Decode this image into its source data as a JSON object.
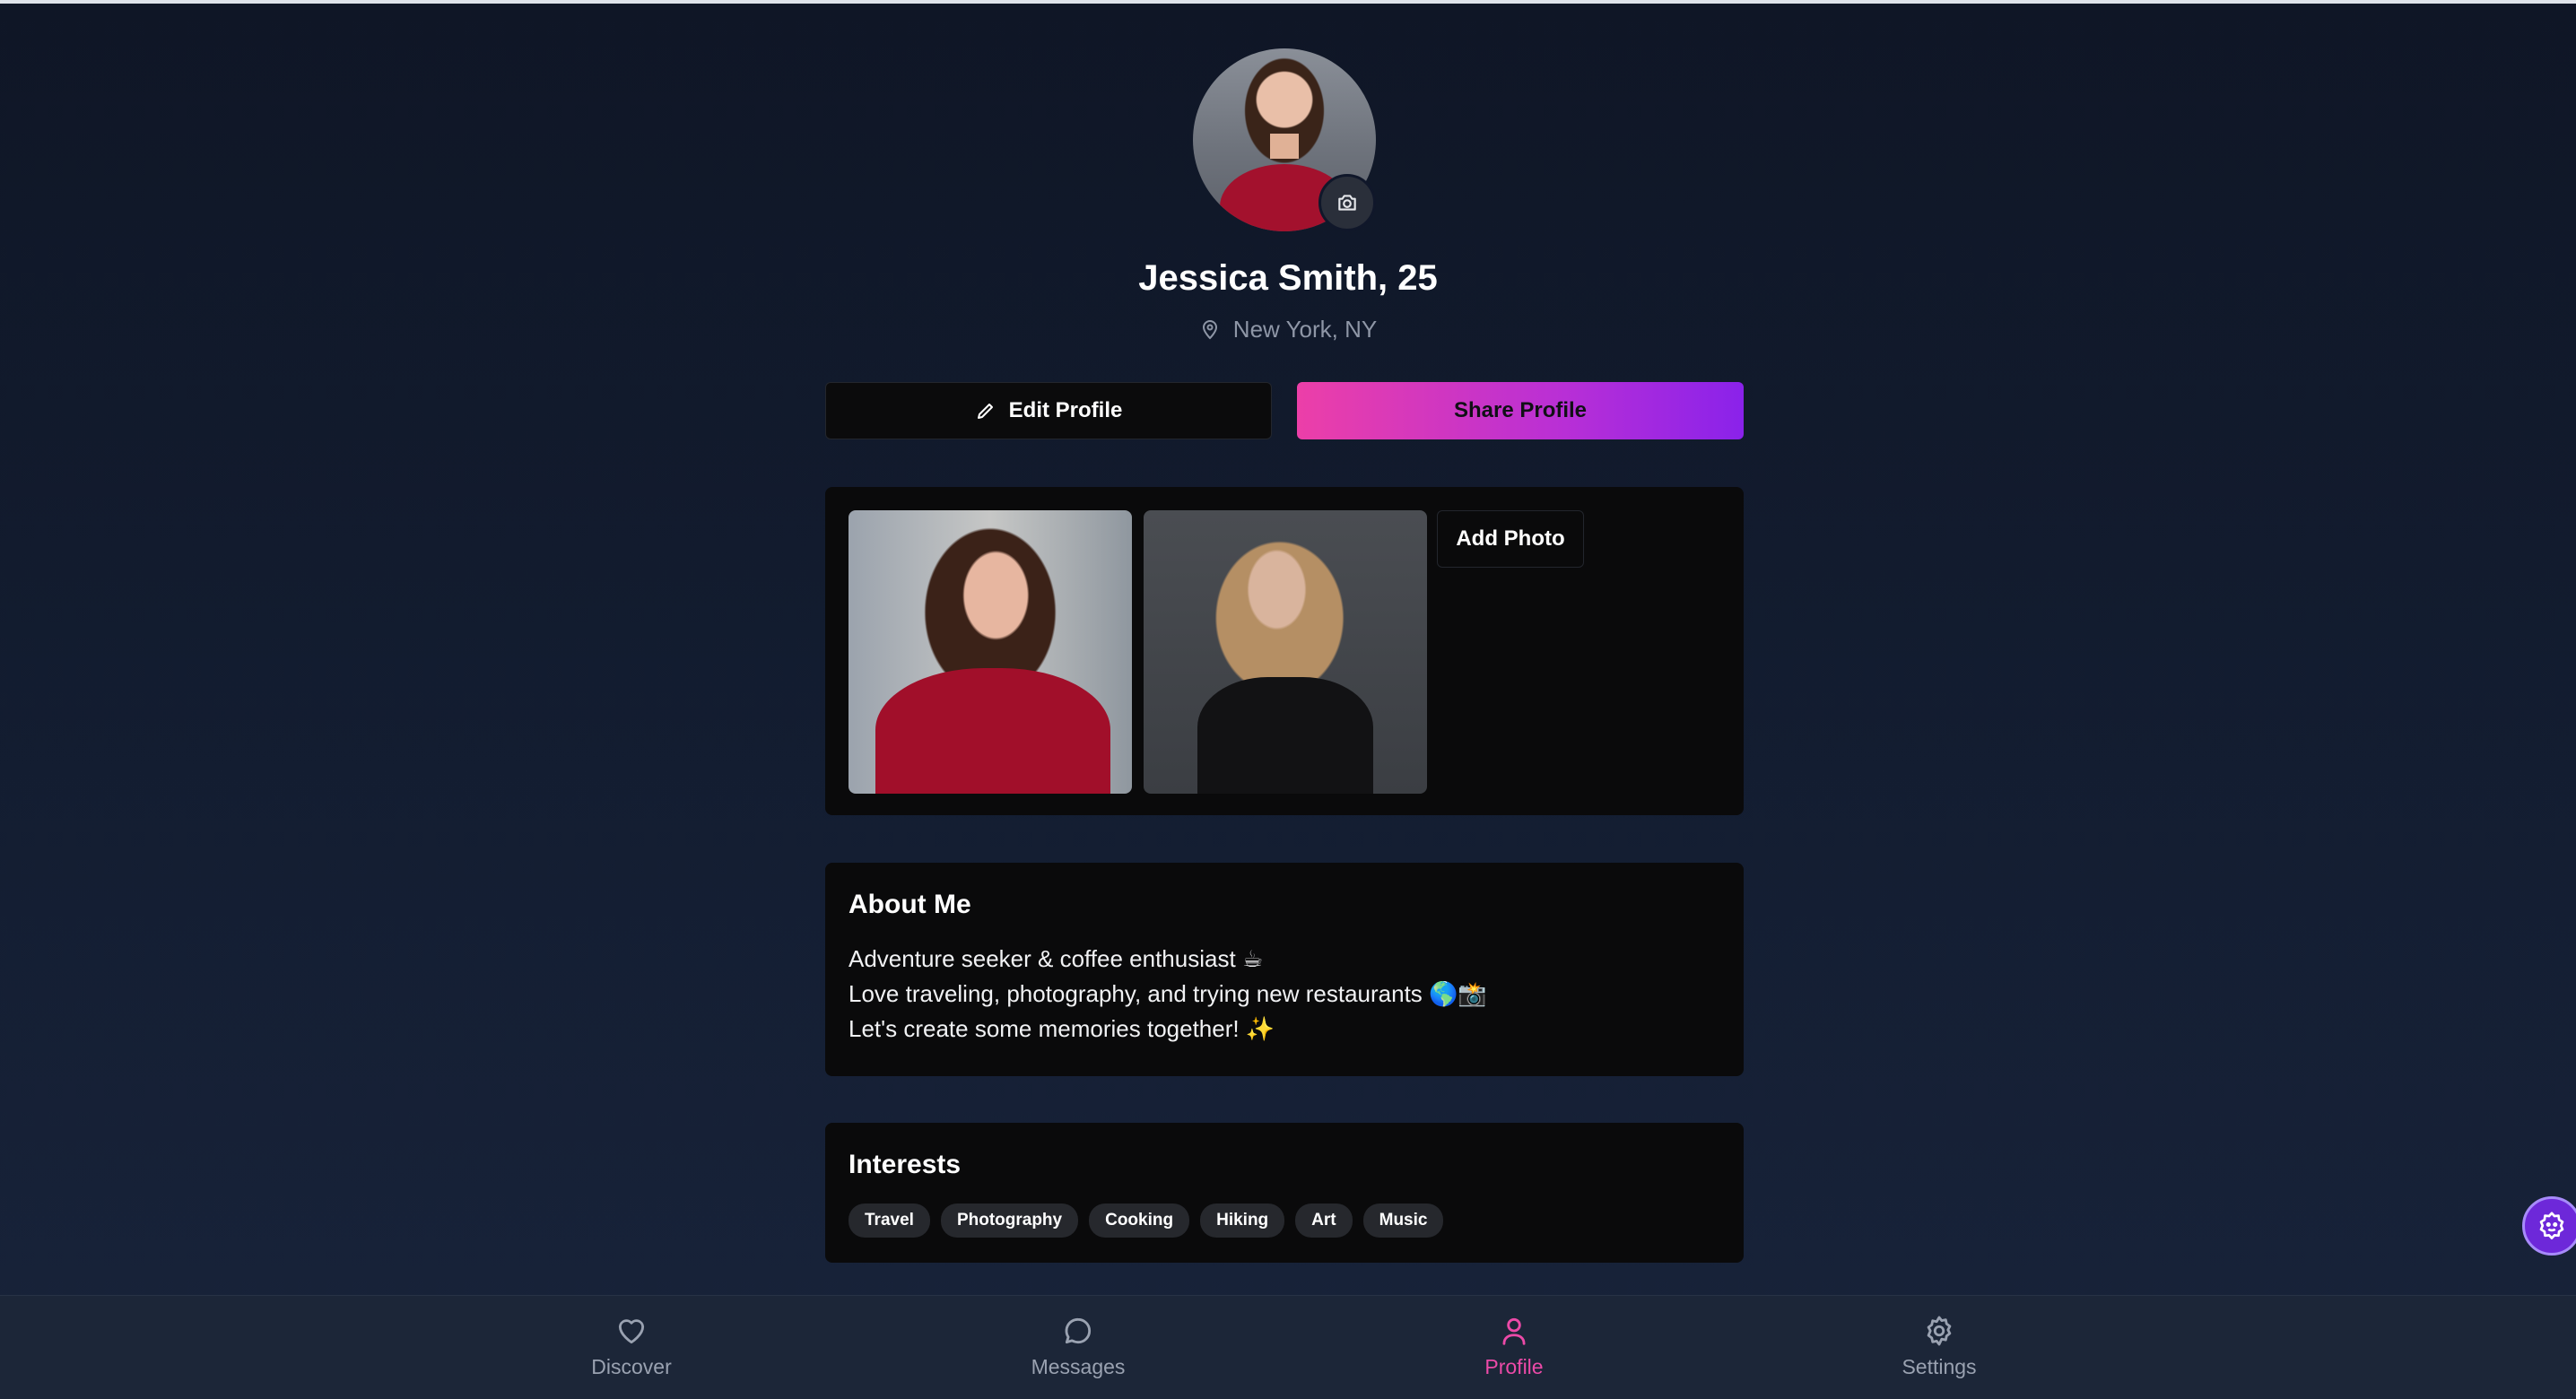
{
  "profile": {
    "name_age": "Jessica Smith, 25",
    "location": "New York, NY"
  },
  "actions": {
    "edit_label": "Edit Profile",
    "share_label": "Share Profile"
  },
  "photos": {
    "add_label": "Add Photo",
    "items": [
      "profile-photo-1",
      "profile-photo-2"
    ]
  },
  "about": {
    "title": "About Me",
    "lines": [
      "Adventure seeker & coffee enthusiast ☕",
      "Love traveling, photography, and trying new restaurants 🌎📸",
      "Let's create some memories together! ✨"
    ]
  },
  "interests": {
    "title": "Interests",
    "tags": [
      "Travel",
      "Photography",
      "Cooking",
      "Hiking",
      "Art",
      "Music"
    ]
  },
  "nav": {
    "items": [
      {
        "label": "Discover",
        "icon": "heart-icon"
      },
      {
        "label": "Messages",
        "icon": "message-icon"
      },
      {
        "label": "Profile",
        "icon": "user-icon"
      },
      {
        "label": "Settings",
        "icon": "gear-icon"
      }
    ],
    "active": "Profile"
  },
  "colors": {
    "accent": "#ec4aa8",
    "accent_end": "#8a22ea",
    "background": "#111a2c",
    "card": "#0a0a0b"
  }
}
